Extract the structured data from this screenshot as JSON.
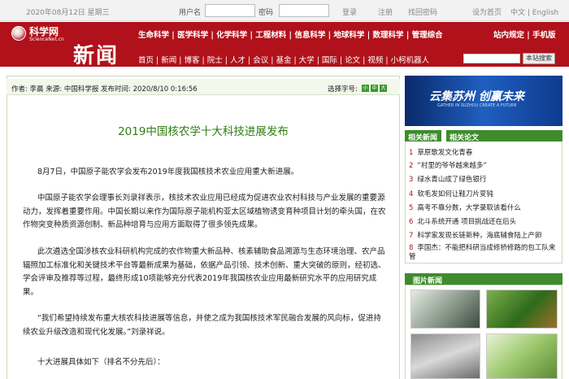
{
  "topbar": {
    "date": "2020年08月12日 星期三",
    "username_label": "用户名",
    "password_label": "密码",
    "login": "登录",
    "register": "注册",
    "find_password": "找回密码",
    "set_home": "设为首页",
    "lang": "中文 | English"
  },
  "header": {
    "logo_cn": "科学网",
    "logo_en": "ScienceNet.cn",
    "section_title": "新闻",
    "nav_primary": "生命科学 | 医学科学 | 化学科学 | 工程材料 | 信息科学 | 地球科学 | 数理科学 | 管理综合",
    "nav_secondary": "首页 | 新闻 | 博客 | 院士 | 人才 | 会议 | 基金 | 大学 | 国际 | 论文 | 视频 | 小柯机器人",
    "right_links": "站内规定 | 手机版",
    "search_button": "本站搜索"
  },
  "article": {
    "meta": "作者: 李晨  来源: 中国科学报  发布时间: 2020/8/10 0:16:56",
    "font_size_label": "选择字号:",
    "font_sizes": [
      "小",
      "中",
      "大"
    ],
    "title": "2019中国核农学十大科技进展发布",
    "paragraphs": [
      "8月7日，中国原子能农学会发布2019年度我国核技术农业应用重大新进展。",
      "中国原子能农学会理事长刘录祥表示，核技术农业应用已经成为促进农业农村科技与产业发展的重要源动力，发挥着重要作用。中国长期以来作为国际原子能机构亚太区域植物诱变育种项目计划的牵头国，在农作物突变种质资源创制、新品种培育与应用方面取得了很多领先成果。",
      "此次遴选全国涉核农业科研机构完成的农作物重大新品种、核素辅助食品溯源与生态环境治理、农产品辐照加工标准化和关键技术平台等最新成果为基础，依据产品引领、技术创新、重大突破的原则，经初选、学会评审及推荐等过程，最终形成10项能够充分代表2019年我国核农业应用最新研究水平的应用研究成果。",
      "“我们希望持续发布重大核农科技进展等信息，并使之成为我国核技术军民融合发展的风向标，促进持续农业升级改造和现代化发展。”刘录祥说。",
      "十大进展具体如下（排名不分先后）："
    ]
  },
  "sidebar": {
    "banner_title": "云集苏州 创赢未来",
    "banner_sub": "GATHER IN SUZHOU CREATE A FUTURE",
    "tab_news": "相关新闻",
    "tab_papers": "相关论文",
    "related": [
      "草原歌发文化青春",
      "“村里的爷爷越来越多”",
      "绿水青山成了绿色银行",
      "软毛发如何让鞋刀片变钝",
      "高考不靠分数，大学录取该看什么",
      "北斗系统开通  项目挑战还在后头",
      "科学家发现长链新种，海底辅食陆上产卵",
      "李国杰：不能把科研当成修桥修路的包工队来管"
    ],
    "picture_news_title": "图片新闻"
  }
}
